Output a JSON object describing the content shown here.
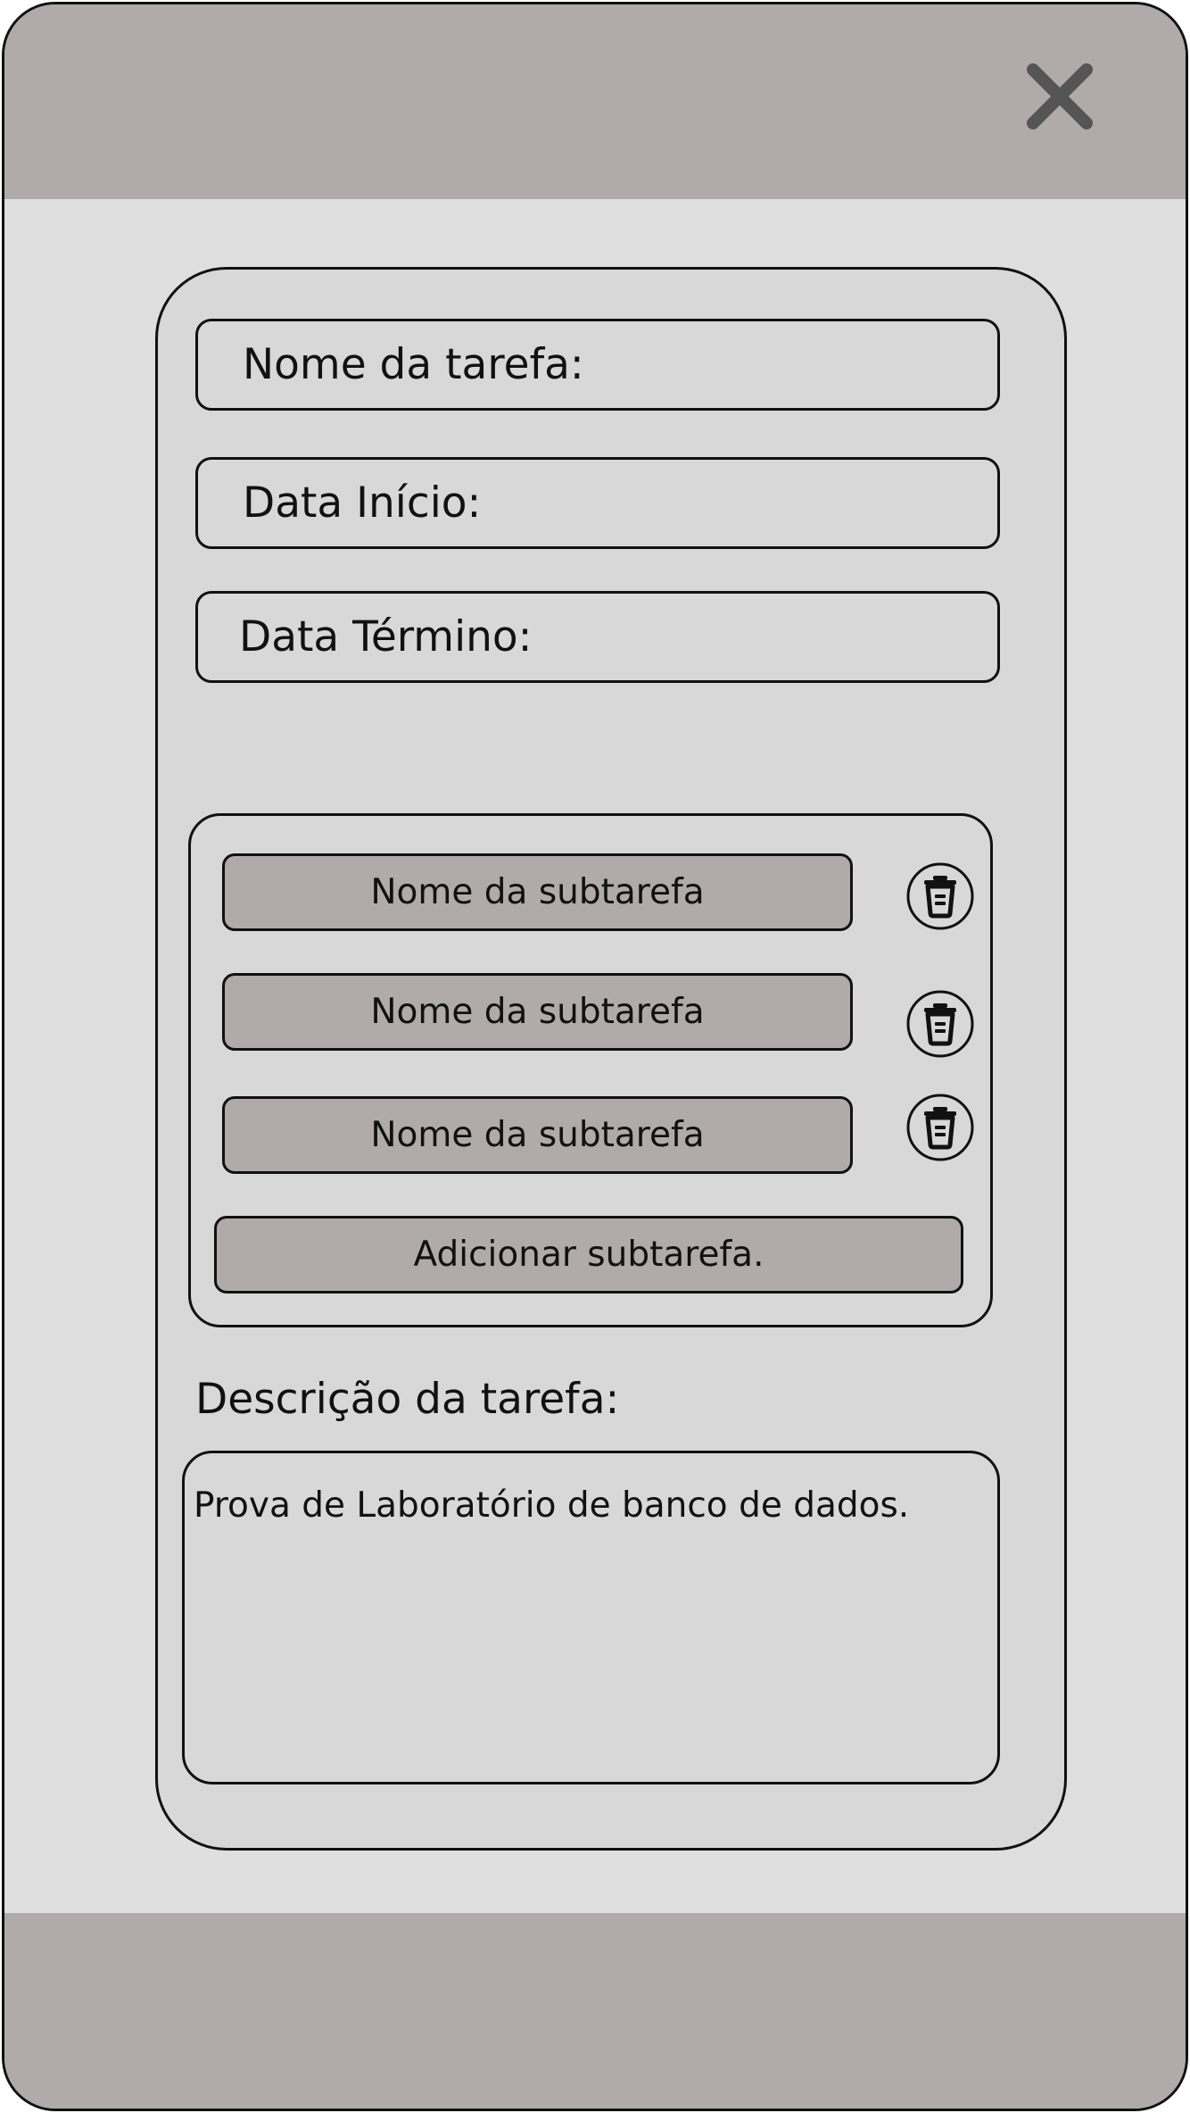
{
  "header": {
    "close_icon": "close-icon"
  },
  "form": {
    "task_name_label": "Nome da tarefa:",
    "start_date_label": "Data Início:",
    "end_date_label": "Data Término:"
  },
  "subtasks": {
    "items": [
      {
        "label": "Nome da subtarefa",
        "delete_icon": "trash-icon"
      },
      {
        "label": "Nome da subtarefa",
        "delete_icon": "trash-icon"
      },
      {
        "label": "Nome da subtarefa",
        "delete_icon": "trash-icon"
      }
    ],
    "add_label": "Adicionar subtarefa."
  },
  "description": {
    "label": "Descrição da tarefa:",
    "value": "Prova de Laboratório de banco de dados."
  },
  "colors": {
    "bar": "#b0aaaa",
    "background": "#dfdfdf",
    "card": "#d8d8d8",
    "border": "#111111",
    "close_icon": "#555555"
  }
}
